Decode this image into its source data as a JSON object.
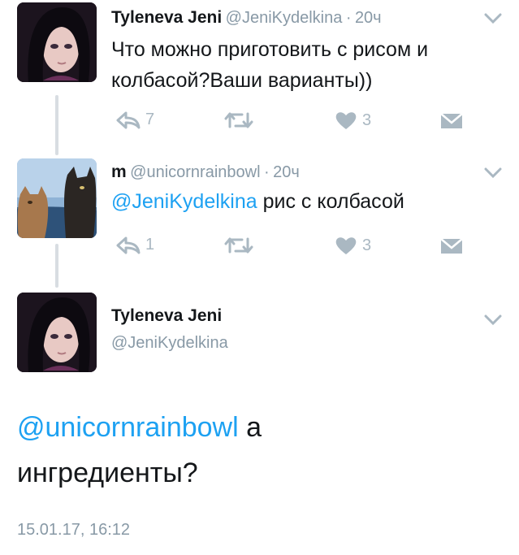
{
  "tweets": [
    {
      "name": "Tyleneva Jeni",
      "handle": "@JeniKydelkina",
      "sep": "·",
      "time": "20ч",
      "text": "Что можно приготовить с рисом и колбасой?Ваши варианты))",
      "reply_count": "7",
      "retweet_count": "",
      "like_count": "3"
    },
    {
      "name": "m",
      "handle": "@unicornrainbowl",
      "sep": "·",
      "time": "20ч",
      "mention": "@JeniKydelkina",
      "text": "рис с колбасой",
      "reply_count": "1",
      "retweet_count": "",
      "like_count": "3"
    }
  ],
  "focused": {
    "name": "Tyleneva Jeni",
    "handle": "@JeniKydelkina",
    "mention": "@unicornrainbowl",
    "text_after_mention": "а",
    "text_line2": "ингредиенты?",
    "date": "15.01.17, 16:12"
  },
  "colors": {
    "accent": "#1da1f2",
    "muted": "#aab8c2",
    "text": "#14171a"
  },
  "icons": [
    "reply-icon",
    "retweet-icon",
    "heart-icon",
    "direct-message-icon",
    "chevron-down-icon"
  ]
}
